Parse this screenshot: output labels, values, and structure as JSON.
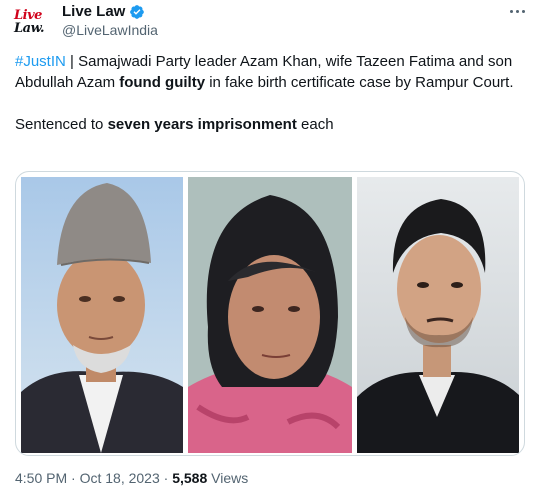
{
  "account": {
    "avatar_line1": "Live",
    "avatar_line2": "Law.",
    "name": "Live Law",
    "handle": "@LiveLawIndia"
  },
  "post": {
    "hashtag": "#JustIN",
    "text_part1": " | Samajwadi Party leader Azam Khan, wife Tazeen Fatima and son Abdullah Azam ",
    "text_bold1": "found guilty",
    "text_part2": " in fake birth certificate case by Rampur Court.",
    "line2_part1": "Sentenced to ",
    "line2_bold": "seven years imprisonment",
    "line2_part2": " each"
  },
  "media": {
    "photos": [
      "man-with-cap-photo",
      "elderly-woman-photo",
      "young-man-photo"
    ]
  },
  "footer": {
    "time": "4:50 PM",
    "sep1": " · ",
    "date": "Oct 18, 2023",
    "sep2": " · ",
    "views_count": "5,588",
    "views_label": " Views"
  },
  "colors": {
    "accent": "#1d9bf0",
    "brand_red": "#d0021b",
    "text": "#0f1419",
    "muted": "#536471"
  }
}
